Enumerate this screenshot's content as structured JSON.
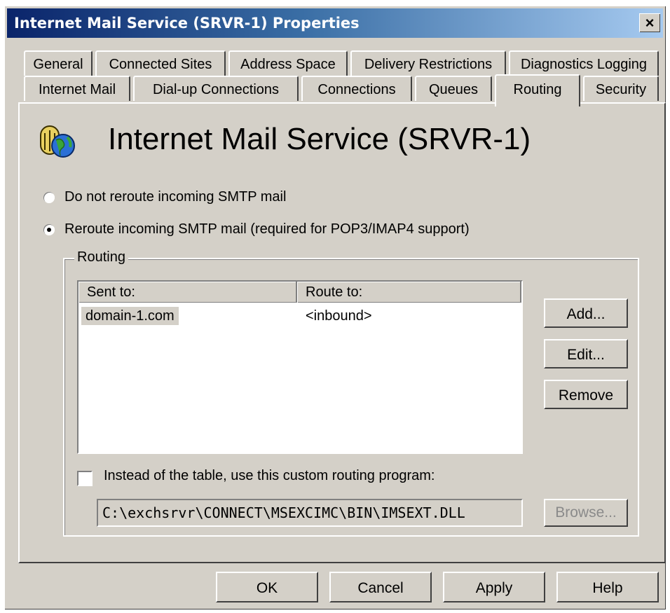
{
  "window": {
    "title": "Internet Mail Service (SRVR-1) Properties",
    "close_glyph": "×"
  },
  "tabs": {
    "row1": [
      "General",
      "Connected Sites",
      "Address Space",
      "Delivery Restrictions",
      "Diagnostics Logging"
    ],
    "row2": [
      "Internet Mail",
      "Dial-up Connections",
      "Connections",
      "Queues",
      "Routing",
      "Security"
    ],
    "active": "Routing"
  },
  "header": {
    "service_title": "Internet Mail Service (SRVR-1)",
    "icon": "globe-mail-icon"
  },
  "options": {
    "no_reroute_label": "Do not reroute incoming SMTP mail",
    "reroute_label": "Reroute incoming SMTP mail (required for POP3/IMAP4 support)",
    "selected": "reroute"
  },
  "routing": {
    "group_label": "Routing",
    "columns": [
      "Sent to:",
      "Route to:"
    ],
    "rows": [
      {
        "sent_to": "domain-1.com",
        "route_to": "<inbound>"
      }
    ],
    "buttons": {
      "add": "Add...",
      "edit": "Edit...",
      "remove": "Remove"
    },
    "custom_program_label": "Instead of the table, use this custom routing program:",
    "custom_program_checked": false,
    "custom_program_path": "C:\\exchsrvr\\CONNECT\\MSEXCIMC\\BIN\\IMSEXT.DLL",
    "browse_label": "Browse..."
  },
  "footer": {
    "ok": "OK",
    "cancel": "Cancel",
    "apply": "Apply",
    "help": "Help"
  }
}
